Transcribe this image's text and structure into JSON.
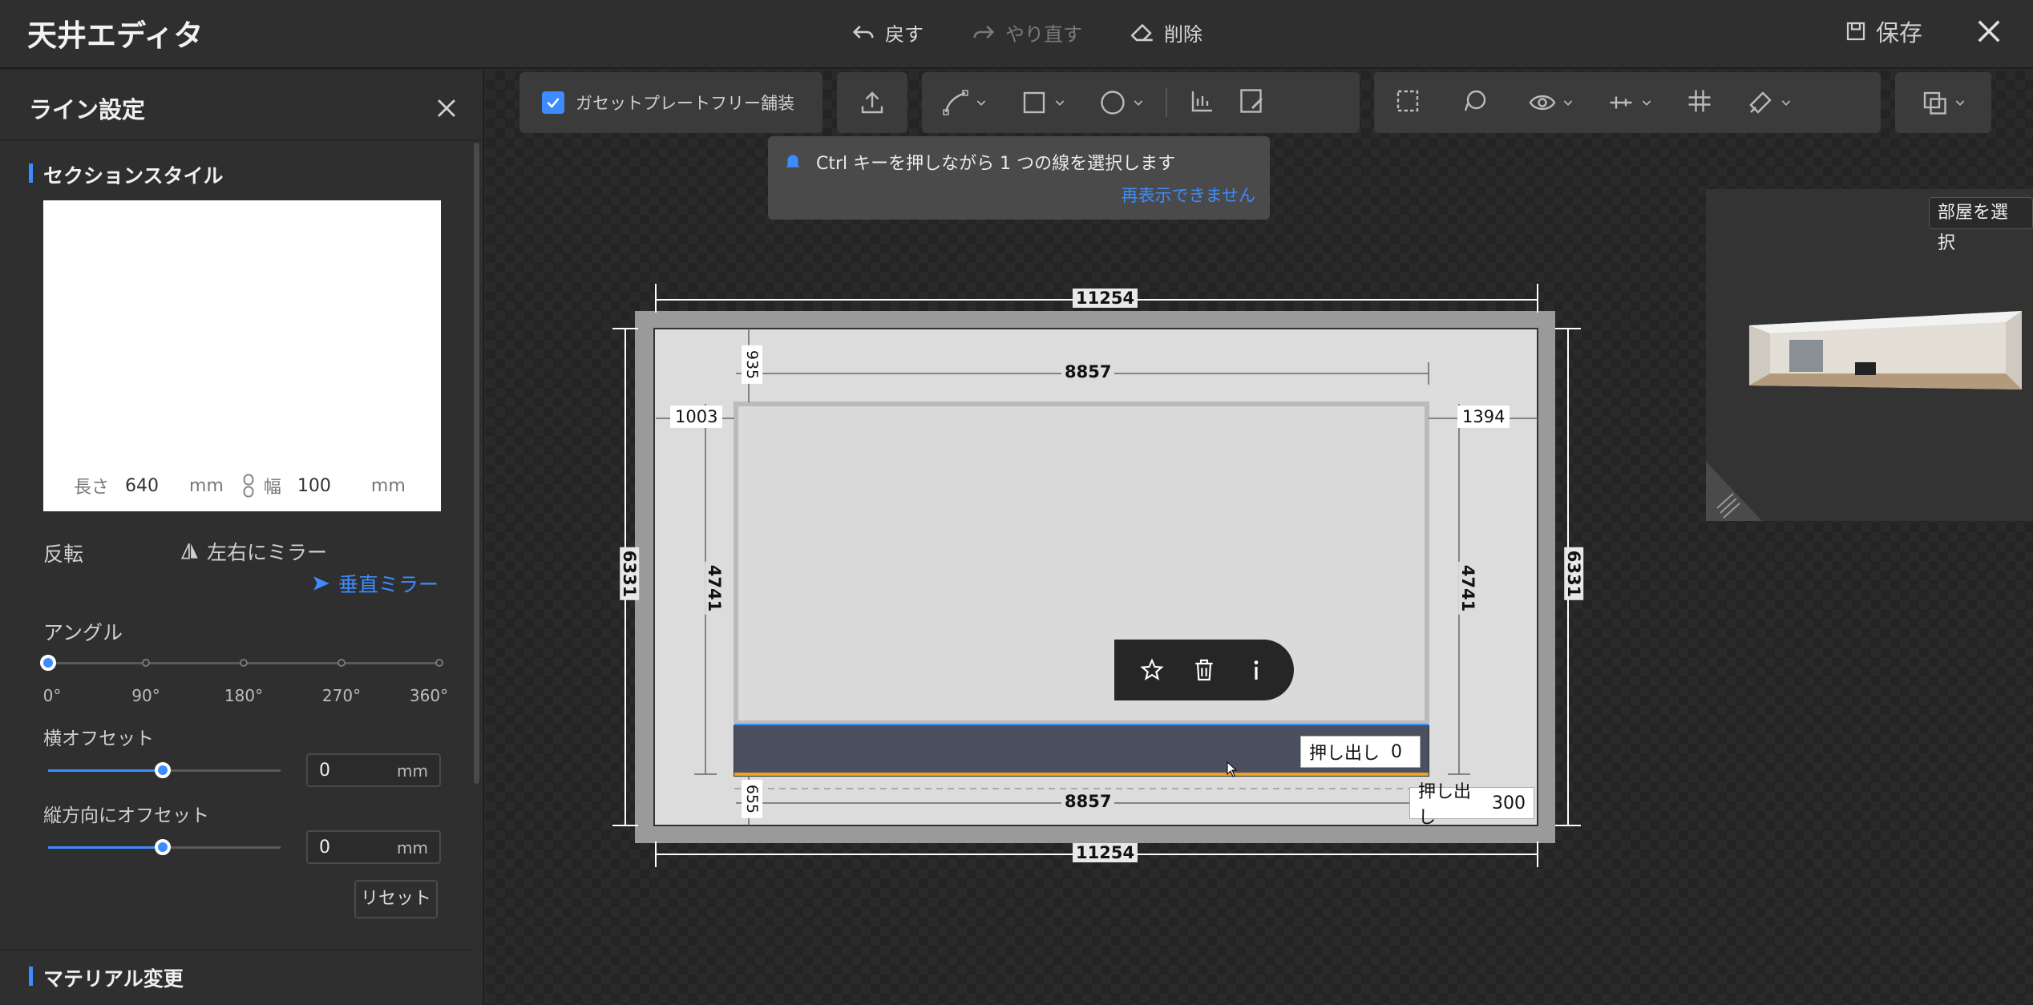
{
  "app": {
    "title": "天井エディタ"
  },
  "top_actions": {
    "undo": "戻す",
    "redo": "やり直す",
    "delete": "削除",
    "save": "保存"
  },
  "left_panel": {
    "title": "ライン設定",
    "section_style": "セクションスタイル",
    "preview": {
      "length_label": "長さ",
      "length_value": "640",
      "length_unit": "mm",
      "width_label": "幅",
      "width_value": "100",
      "width_unit": "mm"
    },
    "flip_label": "反転",
    "mirror_lr": "左右にミラー",
    "mirror_v": "垂直ミラー",
    "angle_label": "アングル",
    "angle_ticks": [
      "0°",
      "90°",
      "180°",
      "270°",
      "360°"
    ],
    "angle_value": 0,
    "h_offset_label": "横オフセット",
    "h_offset_value": "0",
    "h_offset_unit": "mm",
    "v_offset_label": "縦方向にオフセット",
    "v_offset_value": "0",
    "v_offset_unit": "mm",
    "reset": "リセット",
    "material_title": "マテリアル変更"
  },
  "toolbar": {
    "gasket_label": "ガセットプレートフリー舗装",
    "gasket_checked": true
  },
  "tooltip": {
    "message": "Ctrl キーを押しながら 1 つの線を選択します",
    "dismiss": "再表示できません"
  },
  "minimap": {
    "select_room": "部屋を選択"
  },
  "dimensions": {
    "outer_width_top": "11254",
    "outer_width_bottom": "11254",
    "outer_height_left": "6331",
    "outer_height_right": "6331",
    "inner_width_top": "8857",
    "inner_width_bottom": "8857",
    "inner_height_left": "4741",
    "inner_height_right": "4741",
    "top_gap": "935",
    "bottom_gap": "655",
    "left_gap": "1003",
    "right_gap": "1394"
  },
  "extrude": {
    "label_1": "押し出し",
    "value_1": "0",
    "label_2": "押し出し",
    "value_2": "300"
  },
  "colors": {
    "accent": "#3d8cff",
    "selected_strip": "#4a5060",
    "selected_edge": "#f0a020"
  }
}
